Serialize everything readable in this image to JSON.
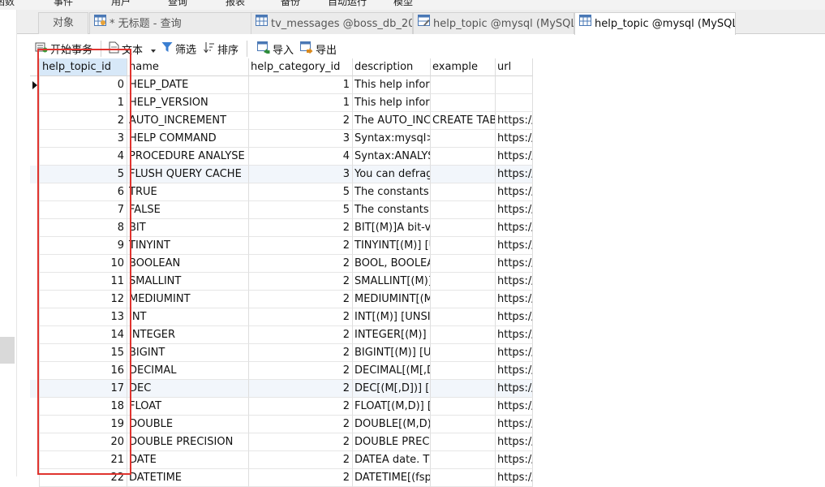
{
  "top_menu": [
    "函数",
    "事件",
    "用户",
    "查询",
    "报表",
    "备份",
    "自动运行",
    "模型"
  ],
  "tabs": [
    {
      "label": "对象",
      "icon": "none",
      "active": false
    },
    {
      "label": "* 无标题 - 查询",
      "icon": "query-grid-icon",
      "active": false
    },
    {
      "label": "tv_messages @boss_db_20...",
      "icon": "table-grid-icon",
      "active": false
    },
    {
      "label": "help_topic @mysql (MySQL...",
      "icon": "table-design-icon",
      "active": false
    },
    {
      "label": "help_topic @mysql (MySQL...",
      "icon": "table-grid-icon",
      "active": true
    }
  ],
  "toolbar": {
    "begin_transaction": "开始事务",
    "text": "文本",
    "filter": "筛选",
    "sort": "排序",
    "import": "导入",
    "export": "导出"
  },
  "columns": [
    "help_topic_id",
    "name",
    "help_category_id",
    "description",
    "example",
    "url"
  ],
  "rows": [
    {
      "help_topic_id": "0",
      "name": "HELP_DATE",
      "help_category_id": "1",
      "description": "This help inform",
      "example": "",
      "url": ""
    },
    {
      "help_topic_id": "1",
      "name": "HELP_VERSION",
      "help_category_id": "1",
      "description": "This help inform",
      "example": "",
      "url": ""
    },
    {
      "help_topic_id": "2",
      "name": "AUTO_INCREMENT",
      "help_category_id": "2",
      "description": "The AUTO_INCR",
      "example": "CREATE TABL",
      "url": "https://"
    },
    {
      "help_topic_id": "3",
      "name": "HELP COMMAND",
      "help_category_id": "3",
      "description": "Syntax:mysql> h",
      "example": "",
      "url": "https://"
    },
    {
      "help_topic_id": "4",
      "name": "PROCEDURE ANALYSE",
      "help_category_id": "4",
      "description": "Syntax:ANALYSE",
      "example": "",
      "url": "https://"
    },
    {
      "help_topic_id": "5",
      "name": "FLUSH QUERY CACHE",
      "help_category_id": "3",
      "description": "You can defragr",
      "example": "",
      "url": "https://"
    },
    {
      "help_topic_id": "6",
      "name": "TRUE",
      "help_category_id": "5",
      "description": "The constants Tl",
      "example": "",
      "url": "https://"
    },
    {
      "help_topic_id": "7",
      "name": "FALSE",
      "help_category_id": "5",
      "description": "The constants Tl",
      "example": "",
      "url": "https://"
    },
    {
      "help_topic_id": "8",
      "name": "BIT",
      "help_category_id": "2",
      "description": "BIT[(M)]A bit-va",
      "example": "",
      "url": "https://"
    },
    {
      "help_topic_id": "9",
      "name": "TINYINT",
      "help_category_id": "2",
      "description": "TINYINT[(M)] [U",
      "example": "",
      "url": "https://"
    },
    {
      "help_topic_id": "10",
      "name": "BOOLEAN",
      "help_category_id": "2",
      "description": "BOOL, BOOLEAI",
      "example": "",
      "url": "https://"
    },
    {
      "help_topic_id": "11",
      "name": "SMALLINT",
      "help_category_id": "2",
      "description": "SMALLINT[(M)]",
      "example": "",
      "url": "https://"
    },
    {
      "help_topic_id": "12",
      "name": "MEDIUMINT",
      "help_category_id": "2",
      "description": "MEDIUMINT[(M",
      "example": "",
      "url": "https://"
    },
    {
      "help_topic_id": "13",
      "name": "INT",
      "help_category_id": "2",
      "description": "INT[(M)] [UNSIG",
      "example": "",
      "url": "https://"
    },
    {
      "help_topic_id": "14",
      "name": "INTEGER",
      "help_category_id": "2",
      "description": "INTEGER[(M)] [L",
      "example": "",
      "url": "https://"
    },
    {
      "help_topic_id": "15",
      "name": "BIGINT",
      "help_category_id": "2",
      "description": "BIGINT[(M)] [UN",
      "example": "",
      "url": "https://"
    },
    {
      "help_topic_id": "16",
      "name": "DECIMAL",
      "help_category_id": "2",
      "description": "DECIMAL[(M[,D]",
      "example": "",
      "url": "https://"
    },
    {
      "help_topic_id": "17",
      "name": "DEC",
      "help_category_id": "2",
      "description": "DEC[(M[,D])] [UI",
      "example": "",
      "url": "https://"
    },
    {
      "help_topic_id": "18",
      "name": "FLOAT",
      "help_category_id": "2",
      "description": "FLOAT[(M,D)] [U",
      "example": "",
      "url": "https://"
    },
    {
      "help_topic_id": "19",
      "name": "DOUBLE",
      "help_category_id": "2",
      "description": "DOUBLE[(M,D)]",
      "example": "",
      "url": "https://"
    },
    {
      "help_topic_id": "20",
      "name": "DOUBLE PRECISION",
      "help_category_id": "2",
      "description": "DOUBLE PRECIS",
      "example": "",
      "url": "https://"
    },
    {
      "help_topic_id": "21",
      "name": "DATE",
      "help_category_id": "2",
      "description": "DATEA date. The",
      "example": "",
      "url": "https://"
    },
    {
      "help_topic_id": "22",
      "name": "DATETIME",
      "help_category_id": "2",
      "description": "DATETIME[(fsp)",
      "example": "",
      "url": "https://"
    }
  ],
  "colors": {
    "annotation_box": "#e0342f",
    "selected_header": "#d7e8f8",
    "alt_row": "#f2f6fb"
  }
}
